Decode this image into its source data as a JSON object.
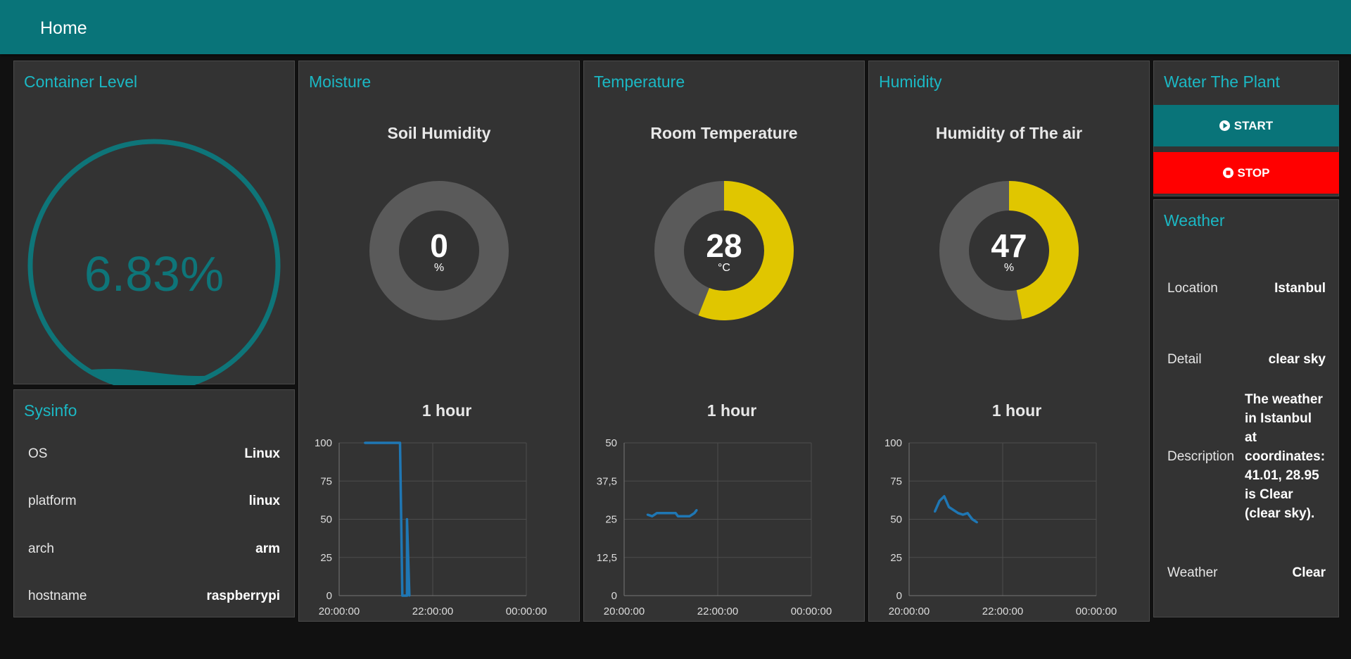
{
  "header": {
    "title": "Home"
  },
  "container_level": {
    "title": "Container Level",
    "value": "6.83%",
    "fill_percent": 6.83,
    "color": "#0e7579"
  },
  "sysinfo": {
    "title": "Sysinfo",
    "rows": [
      {
        "label": "OS",
        "value": "Linux"
      },
      {
        "label": "platform",
        "value": "linux"
      },
      {
        "label": "arch",
        "value": "arm"
      },
      {
        "label": "hostname",
        "value": "raspberrypi"
      }
    ]
  },
  "moisture": {
    "title": "Moisture",
    "gauge_title": "Soil Humidity",
    "value": "0",
    "unit": "%",
    "percent": 0,
    "chart_title": "1 hour"
  },
  "temperature": {
    "title": "Temperature",
    "gauge_title": "Room Temperature",
    "value": "28",
    "unit": "°C",
    "percent": 56,
    "chart_title": "1 hour"
  },
  "humidity": {
    "title": "Humidity",
    "gauge_title": "Humidity of The air",
    "value": "47",
    "unit": "%",
    "percent": 47,
    "chart_title": "1 hour"
  },
  "water": {
    "title": "Water The Plant",
    "start_label": "START",
    "stop_label": "STOP",
    "start_color": "#097479",
    "stop_color": "#ff0000"
  },
  "weather": {
    "title": "Weather",
    "rows": [
      {
        "label": "Location",
        "value": "Istanbul"
      },
      {
        "label": "Detail",
        "value": "clear sky"
      },
      {
        "label": "Description",
        "value": "The weather in Istanbul at coordinates: 41.01, 28.95 is Clear (clear sky)."
      },
      {
        "label": "Weather",
        "value": "Clear"
      }
    ]
  },
  "colors": {
    "accent": "#1bb8c4",
    "gauge_track": "#5a5a5a",
    "gauge_fill": "#e0c600",
    "line": "#1f77b4"
  },
  "chart_data": [
    {
      "type": "line",
      "title": "1 hour",
      "x_ticks": [
        "20:00:00",
        "22:00:00",
        "00:00:00"
      ],
      "y_ticks": [
        "0",
        "25",
        "50",
        "75",
        "100"
      ],
      "ylim": [
        0,
        100
      ],
      "grid": true,
      "series": [
        {
          "values": [
            [
              20.55,
              100
            ],
            [
              21.0,
              100
            ],
            [
              21.3,
              100
            ],
            [
              21.35,
              0
            ],
            [
              21.45,
              0
            ],
            [
              21.45,
              50
            ],
            [
              21.5,
              0
            ]
          ]
        }
      ]
    },
    {
      "type": "line",
      "title": "1 hour",
      "x_ticks": [
        "20:00:00",
        "22:00:00",
        "00:00:00"
      ],
      "y_ticks": [
        "0",
        "12,5",
        "25",
        "37,5",
        "50"
      ],
      "ylim": [
        0,
        50
      ],
      "grid": true,
      "series": [
        {
          "values": [
            [
              20.5,
              26.5
            ],
            [
              20.6,
              26
            ],
            [
              20.7,
              27
            ],
            [
              21.1,
              27
            ],
            [
              21.15,
              26
            ],
            [
              21.4,
              26
            ],
            [
              21.5,
              27
            ],
            [
              21.55,
              28
            ]
          ]
        }
      ]
    },
    {
      "type": "line",
      "title": "1 hour",
      "x_ticks": [
        "20:00:00",
        "22:00:00",
        "00:00:00"
      ],
      "y_ticks": [
        "0",
        "25",
        "50",
        "75",
        "100"
      ],
      "ylim": [
        0,
        100
      ],
      "grid": true,
      "series": [
        {
          "values": [
            [
              20.55,
              55
            ],
            [
              20.65,
              62
            ],
            [
              20.75,
              65
            ],
            [
              20.85,
              58
            ],
            [
              20.95,
              56
            ],
            [
              21.05,
              54
            ],
            [
              21.15,
              53
            ],
            [
              21.25,
              54
            ],
            [
              21.35,
              50
            ],
            [
              21.45,
              48
            ]
          ]
        }
      ]
    }
  ]
}
